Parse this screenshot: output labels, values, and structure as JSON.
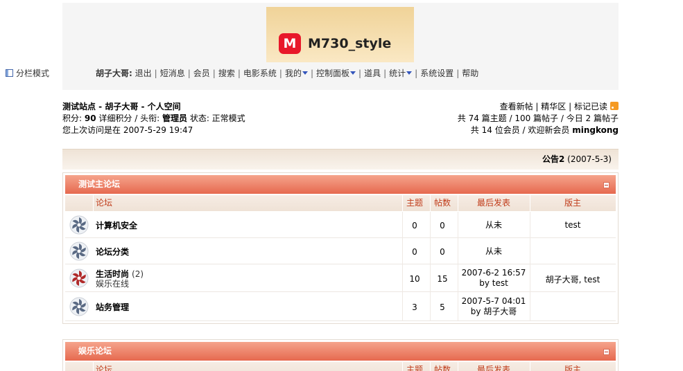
{
  "header": {
    "logo_badge": "M",
    "logo_text": "M730_style",
    "split_mode": "分栏模式",
    "username": "胡子大哥:",
    "nav": [
      {
        "label": "退出",
        "caret": false
      },
      {
        "label": "短消息",
        "caret": false
      },
      {
        "label": "会员",
        "caret": false
      },
      {
        "label": "搜索",
        "caret": false
      },
      {
        "label": "电影系统",
        "caret": false
      },
      {
        "label": "我的",
        "caret": true
      },
      {
        "label": "控制面板",
        "caret": true
      },
      {
        "label": "道具",
        "caret": false
      },
      {
        "label": "统计",
        "caret": true
      },
      {
        "label": "系统设置",
        "caret": false
      },
      {
        "label": "帮助",
        "caret": false
      }
    ]
  },
  "info": {
    "line1": "测试站点 - 胡子大哥  - 个人空间",
    "credit_label": "积分:",
    "credit_value": "90",
    "detail_credit": "详细积分",
    "title_label": "/ 头衔:",
    "title_value": "管理员",
    "status": "状态: 正常模式",
    "last_visit": "您上次访问是在  2007-5-29 19:47",
    "links": [
      "查看新帖",
      "精华区",
      "标记已读"
    ],
    "stats1": "共  74  篇主题  / 100  篇帖子  / 今日  2  篇帖子",
    "stats2_prefix": "共  14  位会员 / 欢迎新会员",
    "newest_member": "mingkong"
  },
  "notice": {
    "title": "公告2",
    "date": "(2007-5-3)"
  },
  "columns": {
    "forum": "论坛",
    "topics": "主题",
    "posts": "帖数",
    "last": "最后发表",
    "mod": "版主"
  },
  "blocks": [
    {
      "title": "测试主论坛",
      "rows": [
        {
          "name": "计算机安全",
          "count": "",
          "sub": "",
          "topics": "0",
          "posts": "0",
          "last1": "从未",
          "last2": "",
          "mod": "test",
          "icon": "new",
          "color": "#5a6a84"
        },
        {
          "name": "论坛分类",
          "count": "",
          "sub": "",
          "topics": "0",
          "posts": "0",
          "last1": "从未",
          "last2": "",
          "mod": "",
          "icon": "new",
          "color": "#5a6a84"
        },
        {
          "name": "生活时尚",
          "count": "(2)",
          "sub": "娱乐在线",
          "topics": "10",
          "posts": "15",
          "last1": "2007-6-2 16:57",
          "last2": "by test",
          "mod": "胡子大哥, test",
          "icon": "hot",
          "color": "#b02a2a"
        },
        {
          "name": "站务管理",
          "count": "",
          "sub": "",
          "topics": "3",
          "posts": "5",
          "last1": "2007-5-7 04:01",
          "last2": "by 胡子大哥",
          "mod": "",
          "icon": "new",
          "color": "#5a6a84"
        }
      ]
    },
    {
      "title": "娱乐论坛",
      "rows": []
    }
  ]
}
